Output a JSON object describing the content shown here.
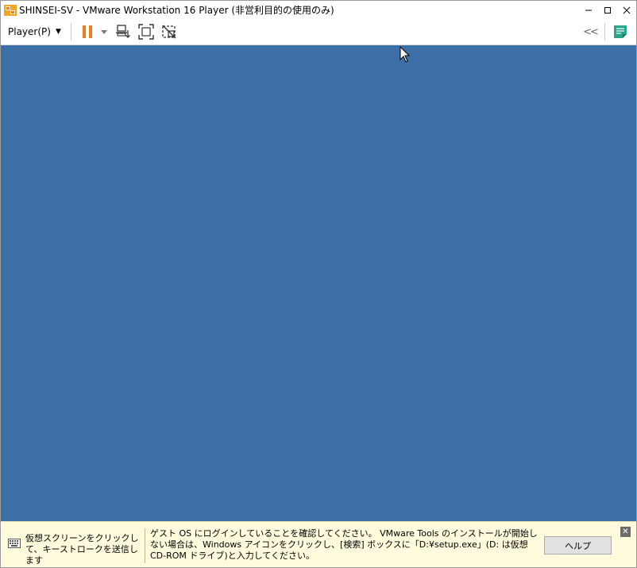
{
  "window": {
    "title": "SHINSEI-SV - VMware Workstation 16 Player (非営利目的の使用のみ)",
    "minimize_glyph": "—",
    "maximize_glyph": "□",
    "close_glyph": "✕"
  },
  "toolbar": {
    "player_menu_label": "Player(P)",
    "icons": [
      "pause-icon",
      "send-ctrl-alt-del-icon",
      "fullscreen-icon",
      "unity-icon",
      "collapse-icon",
      "notes-icon"
    ],
    "collapse_glyph": "<<"
  },
  "vm_screen": {
    "background_color": "#3c6fa6"
  },
  "notification": {
    "hint": "仮想スクリーンをクリックして、キーストロークを送信します",
    "message": "ゲスト OS にログインしていることを確認してください。 VMware Tools のインストールが開始しない場合は、Windows アイコンをクリックし、[検索] ボックスに「D:¥setup.exe」(D: は仮想 CD-ROM ドライブ)と入力してください。",
    "help_button": "ヘルプ",
    "close_glyph": "✕"
  },
  "colors": {
    "accent_orange": "#f07c1b",
    "vm_blue": "#3c6fa6",
    "notify_bg": "#fffbdc",
    "notes_green": "#2aa58c"
  }
}
